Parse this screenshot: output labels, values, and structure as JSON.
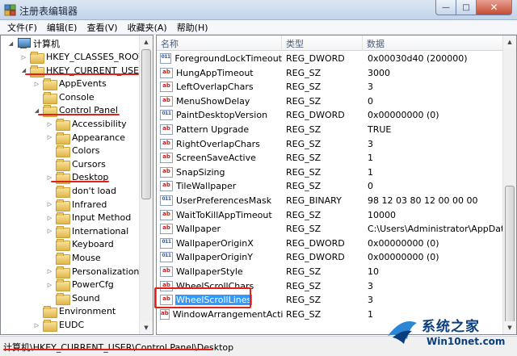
{
  "window": {
    "title": "注册表编辑器",
    "buttons": {
      "minimize": "—",
      "maximize": "□",
      "close": "✕"
    }
  },
  "menu": [
    "文件(F)",
    "编辑(E)",
    "查看(V)",
    "收藏夹(A)",
    "帮助(H)"
  ],
  "tree": {
    "root": "计算机",
    "items": [
      {
        "label": "HKEY_CLASSES_ROOT",
        "level": 1,
        "expander": "▷"
      },
      {
        "label": "HKEY_CURRENT_USER",
        "level": 1,
        "expander": "◢"
      },
      {
        "label": "AppEvents",
        "level": 2,
        "expander": "▷"
      },
      {
        "label": "Console",
        "level": 2,
        "expander": ""
      },
      {
        "label": "Control Panel",
        "level": 2,
        "expander": "◢"
      },
      {
        "label": "Accessibility",
        "level": 3,
        "expander": "▷"
      },
      {
        "label": "Appearance",
        "level": 3,
        "expander": "▷"
      },
      {
        "label": "Colors",
        "level": 3,
        "expander": ""
      },
      {
        "label": "Cursors",
        "level": 3,
        "expander": ""
      },
      {
        "label": "Desktop",
        "level": 3,
        "expander": "▷"
      },
      {
        "label": "don't load",
        "level": 3,
        "expander": ""
      },
      {
        "label": "Infrared",
        "level": 3,
        "expander": "▷"
      },
      {
        "label": "Input Method",
        "level": 3,
        "expander": "▷"
      },
      {
        "label": "International",
        "level": 3,
        "expander": "▷"
      },
      {
        "label": "Keyboard",
        "level": 3,
        "expander": ""
      },
      {
        "label": "Mouse",
        "level": 3,
        "expander": ""
      },
      {
        "label": "Personalization",
        "level": 3,
        "expander": "▷"
      },
      {
        "label": "PowerCfg",
        "level": 3,
        "expander": "▷"
      },
      {
        "label": "Sound",
        "level": 3,
        "expander": ""
      },
      {
        "label": "Environment",
        "level": 2,
        "expander": ""
      },
      {
        "label": "EUDC",
        "level": 2,
        "expander": "▷"
      }
    ]
  },
  "list": {
    "columns": {
      "name": "名称",
      "type": "类型",
      "data": "数据"
    },
    "rows": [
      {
        "icon": "binary-value-icon",
        "name": "ForegroundLockTimeout",
        "type": "REG_DWORD",
        "data": "0x00030d40 (200000)"
      },
      {
        "icon": "string-value-icon",
        "name": "HungAppTimeout",
        "type": "REG_SZ",
        "data": "3000"
      },
      {
        "icon": "string-value-icon",
        "name": "LeftOverlapChars",
        "type": "REG_SZ",
        "data": "3"
      },
      {
        "icon": "string-value-icon",
        "name": "MenuShowDelay",
        "type": "REG_SZ",
        "data": "0"
      },
      {
        "icon": "binary-value-icon",
        "name": "PaintDesktopVersion",
        "type": "REG_DWORD",
        "data": "0x00000000 (0)"
      },
      {
        "icon": "string-value-icon",
        "name": "Pattern Upgrade",
        "type": "REG_SZ",
        "data": "TRUE"
      },
      {
        "icon": "string-value-icon",
        "name": "RightOverlapChars",
        "type": "REG_SZ",
        "data": "3"
      },
      {
        "icon": "string-value-icon",
        "name": "ScreenSaveActive",
        "type": "REG_SZ",
        "data": "1"
      },
      {
        "icon": "string-value-icon",
        "name": "SnapSizing",
        "type": "REG_SZ",
        "data": "1"
      },
      {
        "icon": "string-value-icon",
        "name": "TileWallpaper",
        "type": "REG_SZ",
        "data": "0"
      },
      {
        "icon": "binary-value-icon",
        "name": "UserPreferencesMask",
        "type": "REG_BINARY",
        "data": "98 12 03 80 12 00 00 00"
      },
      {
        "icon": "string-value-icon",
        "name": "WaitToKillAppTimeout",
        "type": "REG_SZ",
        "data": "10000"
      },
      {
        "icon": "string-value-icon",
        "name": "Wallpaper",
        "type": "REG_SZ",
        "data": "C:\\Users\\Administrator\\AppData\\"
      },
      {
        "icon": "binary-value-icon",
        "name": "WallpaperOriginX",
        "type": "REG_DWORD",
        "data": "0x00000000 (0)"
      },
      {
        "icon": "binary-value-icon",
        "name": "WallpaperOriginY",
        "type": "REG_DWORD",
        "data": "0x00000000 (0)"
      },
      {
        "icon": "string-value-icon",
        "name": "WallpaperStyle",
        "type": "REG_SZ",
        "data": "10"
      },
      {
        "icon": "string-value-icon",
        "name": "WheelScrollChars",
        "type": "REG_SZ",
        "data": "3"
      },
      {
        "icon": "string-value-icon",
        "name": "WheelScrollLines",
        "type": "REG_SZ",
        "data": "3",
        "selected": true
      },
      {
        "icon": "string-value-icon",
        "name": "WindowArrangementActive",
        "type": "REG_SZ",
        "data": "1"
      }
    ]
  },
  "status": {
    "path": "计算机\\HKEY_CURRENT_USER\\Control Panel\\Desktop"
  },
  "icons": {
    "string": "ab",
    "binary": "011\n110"
  },
  "watermark": {
    "title": "系统之家",
    "url": "Win10net.com"
  },
  "colors": {
    "selection": "#3399ff",
    "annotation": "#e0201a",
    "string_icon": "#c2241c",
    "binary_icon": "#2f58a8"
  }
}
